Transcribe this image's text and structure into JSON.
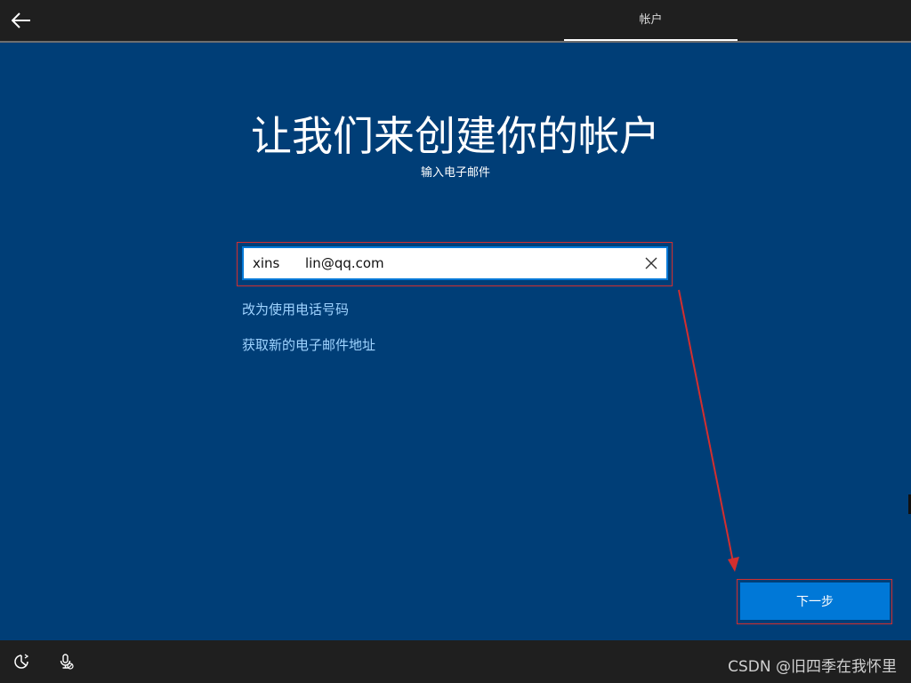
{
  "header": {
    "back_icon": "arrow-left-icon",
    "tab_label": "帐户"
  },
  "main": {
    "title": "让我们来创建你的帐户",
    "subtitle": "输入电子邮件",
    "email": {
      "value": "xins      lin@qq.com",
      "placeholder": ""
    },
    "links": {
      "use_phone": "改为使用电话号码",
      "new_email": "获取新的电子邮件地址"
    },
    "next_label": "下一步"
  },
  "footer": {
    "ease_icon": "ease-of-access-icon",
    "mic_icon": "microphone-off-icon",
    "watermark": "CSDN @旧四季在我怀里"
  },
  "colors": {
    "background": "#003e77",
    "accent": "#0078d7",
    "annotation": "#d32f2f",
    "link": "#9fd3ff"
  }
}
